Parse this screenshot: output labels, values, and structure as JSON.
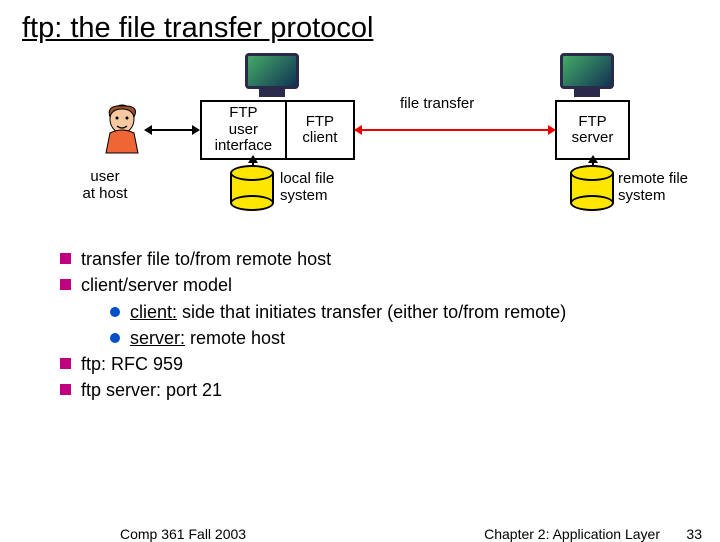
{
  "title": "ftp: the file transfer protocol",
  "diagram": {
    "client_box1_l1": "FTP",
    "client_box1_l2": "user",
    "client_box1_l3": "interface",
    "client_box2_l1": "FTP",
    "client_box2_l2": "client",
    "server_l1": "FTP",
    "server_l2": "server",
    "file_transfer": "file transfer",
    "user_at_host_l1": "user",
    "user_at_host_l2": "at host",
    "local_fs_l1": "local file",
    "local_fs_l2": "system",
    "remote_fs_l1": "remote file",
    "remote_fs_l2": "system"
  },
  "bullets": {
    "b1": "transfer file to/from remote host",
    "b2": "client/server model",
    "b2a_term": "client:",
    "b2a_rest": " side that initiates transfer (either to/from remote)",
    "b2b_term": "server:",
    "b2b_rest": " remote host",
    "b3": "ftp: RFC 959",
    "b4": "ftp server: port 21"
  },
  "footer": {
    "left": "Comp 361   Fall 2003",
    "right": "Chapter 2: Application Layer",
    "num": "33"
  }
}
